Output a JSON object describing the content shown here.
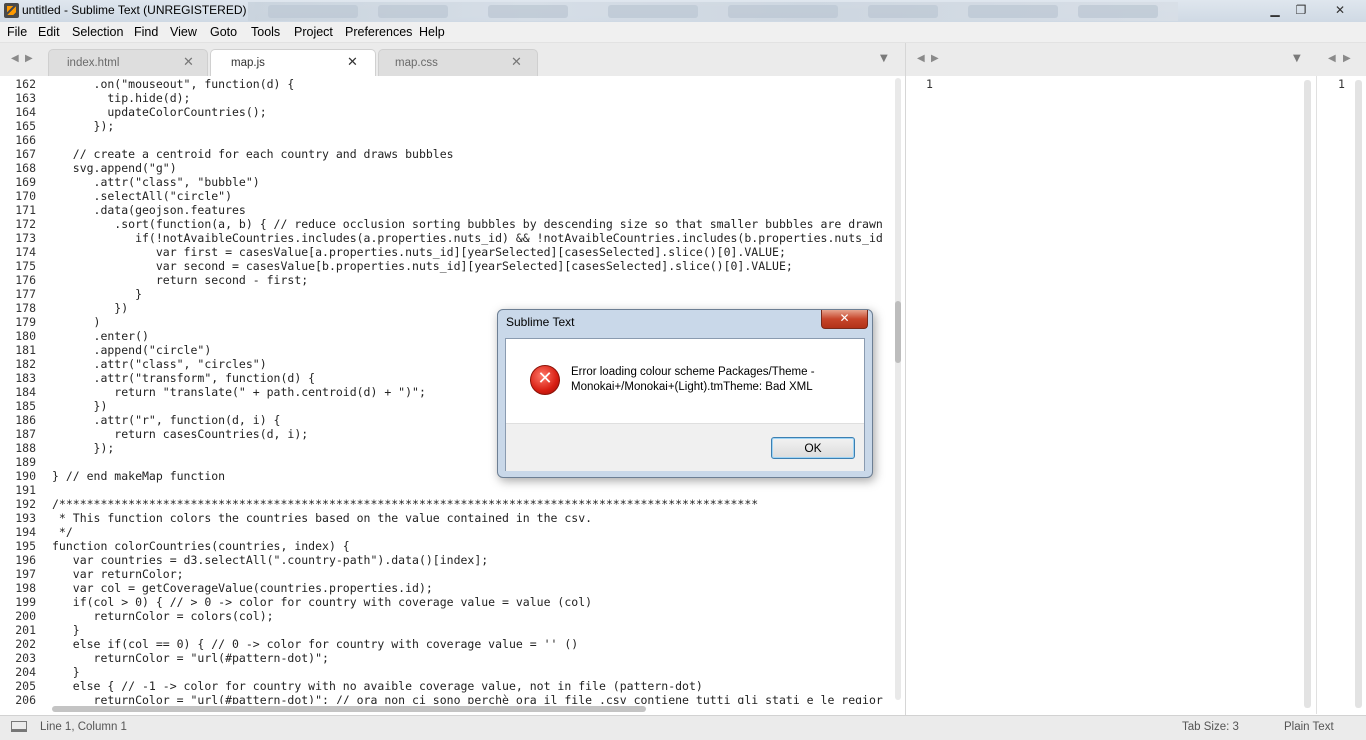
{
  "window": {
    "title": "untitled - Sublime Text (UNREGISTERED)"
  },
  "menu": [
    "File",
    "Edit",
    "Selection",
    "Find",
    "View",
    "Goto",
    "Tools",
    "Project",
    "Preferences",
    "Help"
  ],
  "tabs": [
    {
      "label": "index.html",
      "active": false
    },
    {
      "label": "map.js",
      "active": true
    },
    {
      "label": "map.css",
      "active": false
    }
  ],
  "editor": {
    "lines": [
      {
        "n": "162",
        "t": "      .on(\"mouseout\", function(d) {"
      },
      {
        "n": "163",
        "t": "        tip.hide(d);"
      },
      {
        "n": "164",
        "t": "        updateColorCountries();"
      },
      {
        "n": "165",
        "t": "      });"
      },
      {
        "n": "166",
        "t": ""
      },
      {
        "n": "167",
        "t": "   // create a centroid for each country and draws bubbles"
      },
      {
        "n": "168",
        "t": "   svg.append(\"g\")"
      },
      {
        "n": "169",
        "t": "      .attr(\"class\", \"bubble\")"
      },
      {
        "n": "170",
        "t": "      .selectAll(\"circle\")"
      },
      {
        "n": "171",
        "t": "      .data(geojson.features"
      },
      {
        "n": "172",
        "t": "         .sort(function(a, b) { // reduce occlusion sorting bubbles by descending size so that smaller bubbles are drawn"
      },
      {
        "n": "173",
        "t": "            if(!notAvaibleCountries.includes(a.properties.nuts_id) && !notAvaibleCountries.includes(b.properties.nuts_id"
      },
      {
        "n": "174",
        "t": "               var first = casesValue[a.properties.nuts_id][yearSelected][casesSelected].slice()[0].VALUE;"
      },
      {
        "n": "175",
        "t": "               var second = casesValue[b.properties.nuts_id][yearSelected][casesSelected].slice()[0].VALUE;"
      },
      {
        "n": "176",
        "t": "               return second - first;"
      },
      {
        "n": "177",
        "t": "            }"
      },
      {
        "n": "178",
        "t": "         })"
      },
      {
        "n": "179",
        "t": "      )"
      },
      {
        "n": "180",
        "t": "      .enter()"
      },
      {
        "n": "181",
        "t": "      .append(\"circle\")"
      },
      {
        "n": "182",
        "t": "      .attr(\"class\", \"circles\")"
      },
      {
        "n": "183",
        "t": "      .attr(\"transform\", function(d) {"
      },
      {
        "n": "184",
        "t": "         return \"translate(\" + path.centroid(d) + \")\";"
      },
      {
        "n": "185",
        "t": "      })"
      },
      {
        "n": "186",
        "t": "      .attr(\"r\", function(d, i) {"
      },
      {
        "n": "187",
        "t": "         return casesCountries(d, i);"
      },
      {
        "n": "188",
        "t": "      });"
      },
      {
        "n": "189",
        "t": ""
      },
      {
        "n": "190",
        "t": "} // end makeMap function"
      },
      {
        "n": "191",
        "t": ""
      },
      {
        "n": "192",
        "t": "/*****************************************************************************************************"
      },
      {
        "n": "193",
        "t": " * This function colors the countries based on the value contained in the csv."
      },
      {
        "n": "194",
        "t": " */"
      },
      {
        "n": "195",
        "t": "function colorCountries(countries, index) {"
      },
      {
        "n": "196",
        "t": "   var countries = d3.selectAll(\".country-path\").data()[index];"
      },
      {
        "n": "197",
        "t": "   var returnColor;"
      },
      {
        "n": "198",
        "t": "   var col = getCoverageValue(countries.properties.id);"
      },
      {
        "n": "199",
        "t": "   if(col > 0) { // > 0 -> color for country with coverage value = value (col)"
      },
      {
        "n": "200",
        "t": "      returnColor = colors(col);"
      },
      {
        "n": "201",
        "t": "   }"
      },
      {
        "n": "202",
        "t": "   else if(col == 0) { // 0 -> color for country with coverage value = '' ()"
      },
      {
        "n": "203",
        "t": "      returnColor = \"url(#pattern-dot)\";"
      },
      {
        "n": "204",
        "t": "   }"
      },
      {
        "n": "205",
        "t": "   else { // -1 -> color for country with no avaible coverage value, not in file (pattern-dot)"
      },
      {
        "n": "206",
        "t": "      returnColor = \"url(#pattern-dot)\"; // ora non ci sono perchè ora il file .csv contiene tutti gli stati e le regior"
      }
    ]
  },
  "panes": {
    "pane2_line": "1",
    "pane3_line": "1"
  },
  "status": {
    "position": "Line 1, Column 1",
    "tab_size": "Tab Size: 3",
    "syntax": "Plain Text"
  },
  "dialog": {
    "title": "Sublime Text",
    "message_line1": "Error loading colour scheme Packages/Theme -",
    "message_line2": "Monokai+/Monokai+(Light).tmTheme: Bad XML",
    "ok_label": "OK",
    "close_glyph": "✕",
    "error_glyph": "✕"
  },
  "icons": {
    "minimize": "▁",
    "maximize": "❐",
    "close": "✕",
    "tab_close": "✕",
    "nav_left": "◀",
    "nav_right": "▶",
    "dropdown": "▼"
  }
}
